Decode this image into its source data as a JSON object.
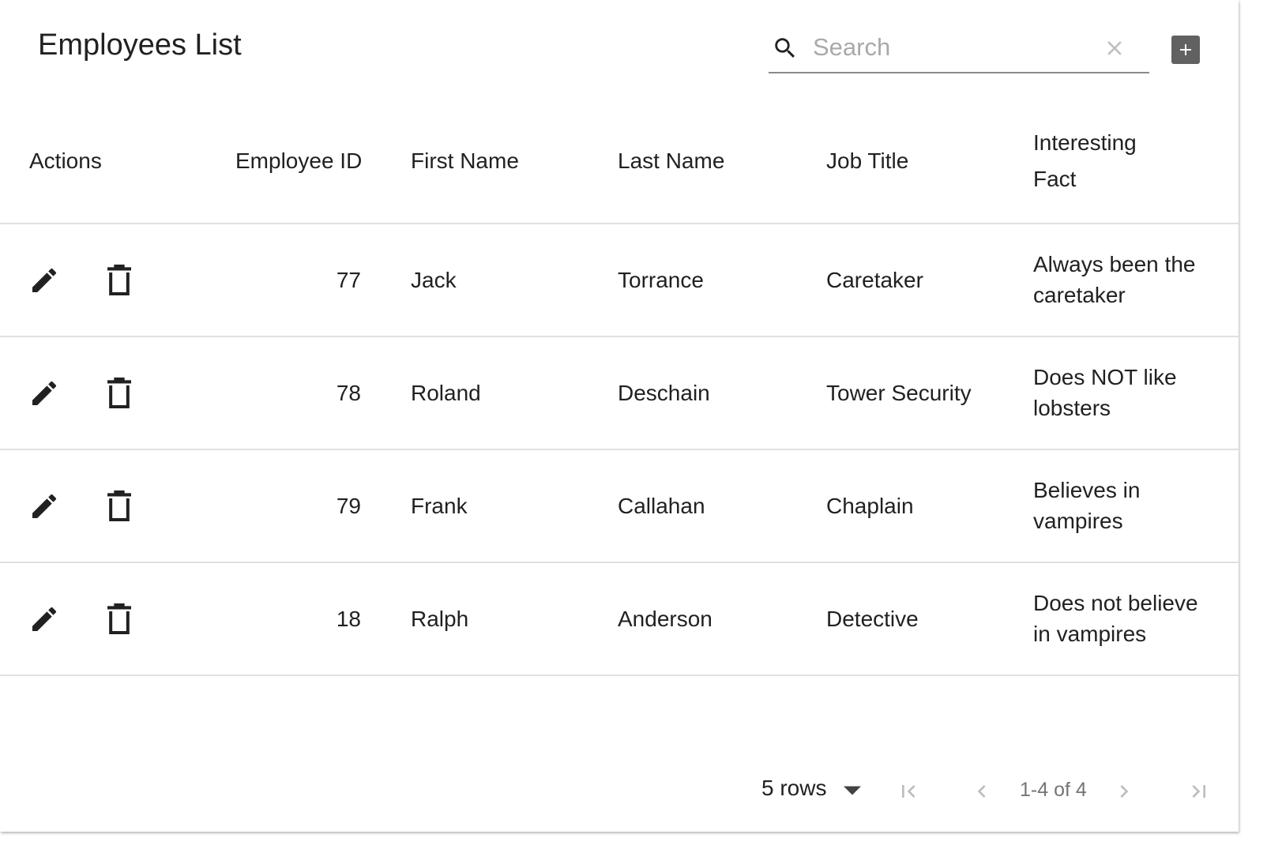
{
  "header": {
    "title": "Employees List",
    "search_placeholder": "Search",
    "search_value": ""
  },
  "table": {
    "columns": [
      "Actions",
      "Employee ID",
      "First Name",
      "Last Name",
      "Job Title",
      "Interesting Fact"
    ],
    "column_wrap": {
      "interesting_fact_line1": "Interesting",
      "interesting_fact_line2": "Fact"
    },
    "rows": [
      {
        "id": "77",
        "first": "Jack",
        "last": "Torrance",
        "job": "Caretaker",
        "fact1": "Always been the",
        "fact2": "caretaker"
      },
      {
        "id": "78",
        "first": "Roland",
        "last": "Deschain",
        "job": "Tower Security",
        "fact1": "Does NOT like",
        "fact2": "lobsters"
      },
      {
        "id": "79",
        "first": "Frank",
        "last": "Callahan",
        "job": "Chaplain",
        "fact1": "Believes in",
        "fact2": "vampires"
      },
      {
        "id": "18",
        "first": "Ralph",
        "last": "Anderson",
        "job": "Detective",
        "fact1": "Does not believe",
        "fact2": "in vampires"
      }
    ]
  },
  "footer": {
    "rows_per_page": "5 rows",
    "page_range": "1-4 of 4"
  },
  "icons": {
    "search": "search-icon",
    "clear": "close-icon",
    "add": "add-box-icon",
    "edit": "pencil-icon",
    "delete": "trash-icon",
    "first": "first-page-icon",
    "prev": "chevron-left-icon",
    "next": "chevron-right-icon",
    "last": "last-page-icon"
  },
  "colors": {
    "text": "#212121",
    "muted": "#757575",
    "divider": "#e0e0e0",
    "add_button": "#616161"
  }
}
